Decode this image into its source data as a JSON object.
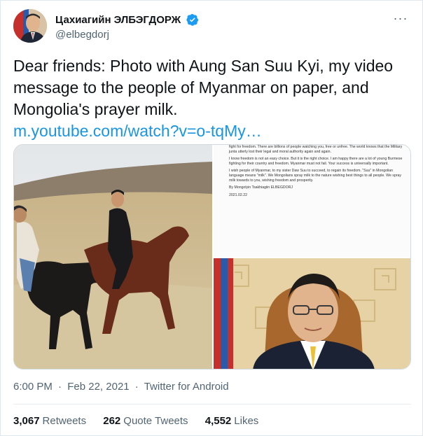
{
  "author": {
    "display_name": "Цахиагийн ЭЛБЭГДОРЖ",
    "handle": "@elbegdorj",
    "verified": true,
    "avatar_icon": "avatar"
  },
  "more_icon": "more-options-icon",
  "tweet": {
    "text": "Dear friends: Photo with Aung San Suu Kyi, my video message to the people of Myanmar on paper, and Mongolia's prayer milk.",
    "link": "m.youtube.com/watch?v=o-tqMy…"
  },
  "letter": {
    "p1": "fight for freedom. There are billions of people watching you, free or unfree. The world knows that the Military junta utterly lost their legal and moral authority again and again.",
    "p2": "I know freedom is not an easy choice. But it is the right choice. I am happy there are a lot of young Burmese fighting for their country and freedom. Myanmar must not fail. Your success is universally important.",
    "p3": "I wish people of Myanmar, to my sister Daw Suu to succeed, to regain its freedom. \"Suu\" in Mongolian language means \"milk\". We Mongolians spray milk to the nature wishing best things to all people. We spray milk towards to you, wishing freedom and prosperity.",
    "signature": "By Mongolyin Tsakhiagiin ELBEGDORJ",
    "date": "2021.02.22"
  },
  "meta": {
    "time": "6:00 PM",
    "separator": "·",
    "date": "Feb 22, 2021",
    "source": "Twitter for Android"
  },
  "stats": {
    "retweets_count": "3,067",
    "retweets_label": "Retweets",
    "quotes_count": "262",
    "quotes_label": "Quote Tweets",
    "likes_count": "4,552",
    "likes_label": "Likes"
  },
  "colors": {
    "link": "#1b95e0",
    "verified": "#1d9bf0",
    "secondary_text": "#536471"
  }
}
